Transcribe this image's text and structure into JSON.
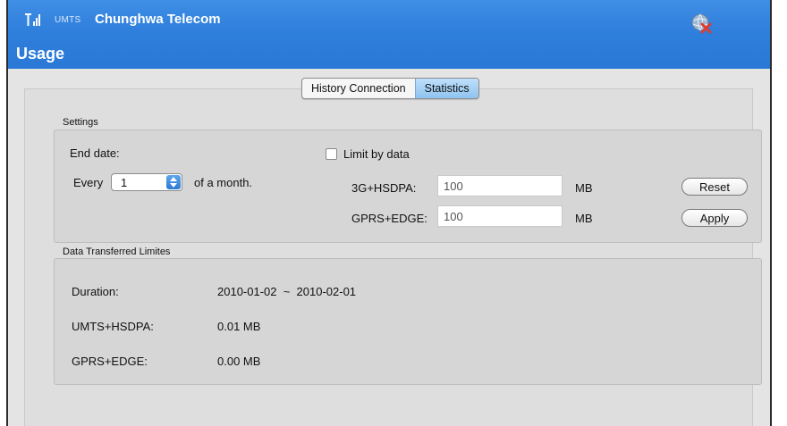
{
  "titlebar": {
    "network": "UMTS",
    "carrier": "Chunghwa Telecom",
    "section_title": "Usage"
  },
  "tabs": {
    "history": "History Connection",
    "statistics": "Statistics"
  },
  "settings": {
    "section_label": "Settings",
    "end_date_label": "End date:",
    "every_label": "Every",
    "day_value": "1",
    "of_month_label": "of a month.",
    "limit_label": "Limit by data",
    "hsdpa_label": "3G+HSDPA:",
    "hsdpa_value": "100",
    "hsdpa_unit": "MB",
    "edge_label": "GPRS+EDGE:",
    "edge_value": "100",
    "edge_unit": "MB",
    "reset_label": "Reset",
    "apply_label": "Apply"
  },
  "transfer": {
    "section_label": "Data Transferred  Limites",
    "duration_label": "Duration:",
    "duration_value": "2010-01-02  ~  2010-02-01",
    "umts_label": "UMTS+HSDPA:",
    "umts_value": "0.01 MB",
    "gprs_label": "GPRS+EDGE:",
    "gprs_value": "0.00 MB"
  },
  "icons": {
    "signal": "signal-strength-icon",
    "disconnect": "globe-disconnect-icon",
    "stepper": "stepper-arrows-icon"
  },
  "colors": {
    "titlebar": "#2f7fdc",
    "active_tab": "#9fcdf4",
    "disconnect_x": "#e23b2e"
  }
}
